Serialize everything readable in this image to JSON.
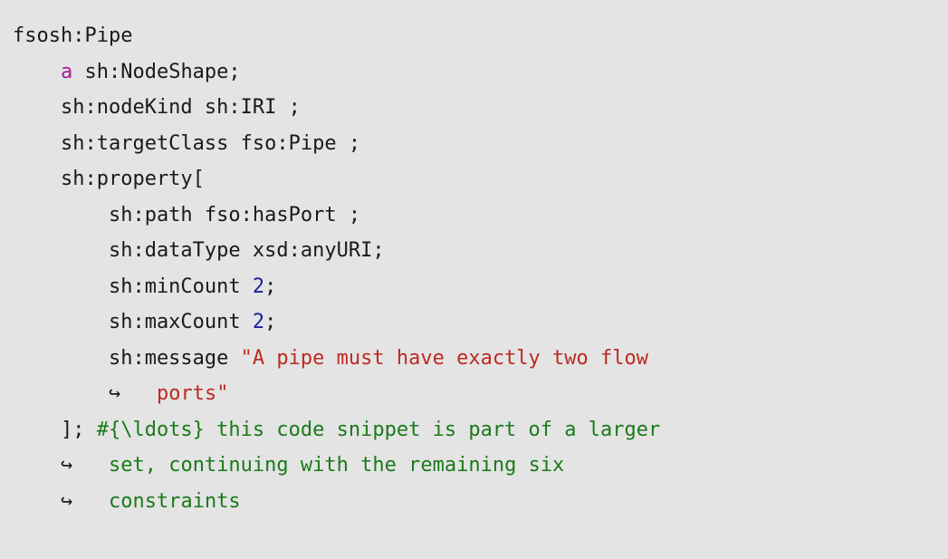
{
  "listing": {
    "language": "turtle-shacl",
    "background_color": "#e4e4e4",
    "token_colors": {
      "default": "#1a1a1a",
      "keyword": "#a6199a",
      "number": "#1f1f9e",
      "string": "#bc2a22",
      "comment": "#1a7a1a"
    },
    "continuation_glyph": "↪",
    "lines": [
      {
        "id": "line-1",
        "wrapped": false,
        "tokens": [
          {
            "type": "default",
            "text": "fsosh:Pipe"
          }
        ]
      },
      {
        "id": "line-2",
        "wrapped": false,
        "tokens": [
          {
            "type": "default",
            "text": "    "
          },
          {
            "type": "keyword",
            "text": "a"
          },
          {
            "type": "default",
            "text": " sh:NodeShape;"
          }
        ]
      },
      {
        "id": "line-3",
        "wrapped": false,
        "tokens": [
          {
            "type": "default",
            "text": "    sh:nodeKind sh:IRI ;"
          }
        ]
      },
      {
        "id": "line-4",
        "wrapped": false,
        "tokens": [
          {
            "type": "default",
            "text": "    sh:targetClass fso:Pipe ;"
          }
        ]
      },
      {
        "id": "line-5",
        "wrapped": false,
        "tokens": [
          {
            "type": "default",
            "text": "    sh:property["
          }
        ]
      },
      {
        "id": "line-6",
        "wrapped": false,
        "tokens": [
          {
            "type": "default",
            "text": "        sh:path fso:hasPort ;"
          }
        ]
      },
      {
        "id": "line-7",
        "wrapped": false,
        "tokens": [
          {
            "type": "default",
            "text": "        sh:dataType xsd:anyURI;"
          }
        ]
      },
      {
        "id": "line-8",
        "wrapped": false,
        "tokens": [
          {
            "type": "default",
            "text": "        sh:minCount "
          },
          {
            "type": "number",
            "text": "2"
          },
          {
            "type": "default",
            "text": ";"
          }
        ]
      },
      {
        "id": "line-9",
        "wrapped": false,
        "tokens": [
          {
            "type": "default",
            "text": "        sh:maxCount "
          },
          {
            "type": "number",
            "text": "2"
          },
          {
            "type": "default",
            "text": ";"
          }
        ]
      },
      {
        "id": "line-10",
        "wrapped": false,
        "tokens": [
          {
            "type": "default",
            "text": "        sh:message "
          },
          {
            "type": "string",
            "text": "\"A pipe must have exactly two flow"
          }
        ]
      },
      {
        "id": "line-11",
        "wrapped": true,
        "tokens": [
          {
            "type": "default",
            "text": "        "
          },
          {
            "type": "arrow",
            "text": "↪"
          },
          {
            "type": "default",
            "text": "   "
          },
          {
            "type": "string",
            "text": "ports\""
          }
        ]
      },
      {
        "id": "line-12",
        "wrapped": false,
        "tokens": [
          {
            "type": "default",
            "text": "    ]; "
          },
          {
            "type": "comment",
            "text": "#{\\ldots} this code snippet is part of a larger"
          }
        ]
      },
      {
        "id": "line-13",
        "wrapped": true,
        "tokens": [
          {
            "type": "default",
            "text": "    "
          },
          {
            "type": "arrow",
            "text": "↪"
          },
          {
            "type": "default",
            "text": "   "
          },
          {
            "type": "comment",
            "text": "set, continuing with the remaining six"
          }
        ]
      },
      {
        "id": "line-14",
        "wrapped": true,
        "tokens": [
          {
            "type": "default",
            "text": "    "
          },
          {
            "type": "arrow",
            "text": "↪"
          },
          {
            "type": "default",
            "text": "   "
          },
          {
            "type": "comment",
            "text": "constraints"
          }
        ]
      }
    ]
  }
}
